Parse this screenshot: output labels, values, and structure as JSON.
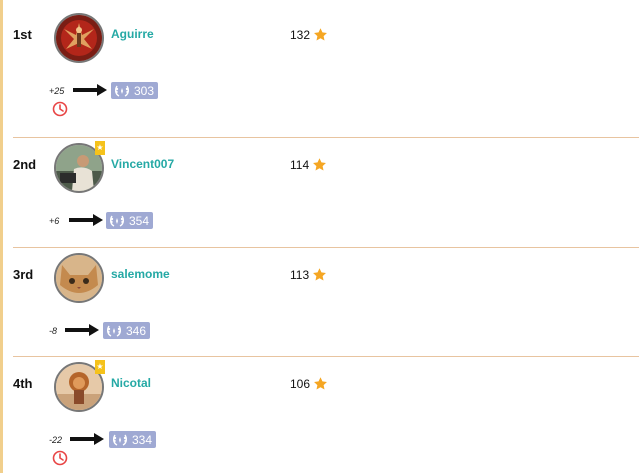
{
  "leaderboard": [
    {
      "rank": "1st",
      "name": "Aguirre",
      "score": "132",
      "delta": "+25",
      "level": "303",
      "premium": false,
      "clock": true,
      "avatar": "dark-red"
    },
    {
      "rank": "2nd",
      "name": "Vincent007",
      "score": "114",
      "delta": "+6",
      "level": "354",
      "premium": true,
      "clock": false,
      "avatar": "man-car"
    },
    {
      "rank": "3rd",
      "name": "salemome",
      "score": "113",
      "delta": "-8",
      "level": "346",
      "premium": false,
      "clock": false,
      "avatar": "cat"
    },
    {
      "rank": "4th",
      "name": "Nicotal",
      "score": "106",
      "delta": "-22",
      "level": "334",
      "premium": true,
      "clock": true,
      "avatar": "lion"
    }
  ],
  "colors": {
    "name": "#25a9a5",
    "star": "#f5a623",
    "badge": "#9fa9d3",
    "clock": "#e84545",
    "premium": "#f5c21b",
    "divider": "#e8c4a0"
  },
  "icons": {
    "star": "star-icon",
    "laurel": "laurel-icon",
    "arrow": "arrow-right-icon",
    "clock": "clock-icon",
    "premium": "premium-badge-icon"
  }
}
